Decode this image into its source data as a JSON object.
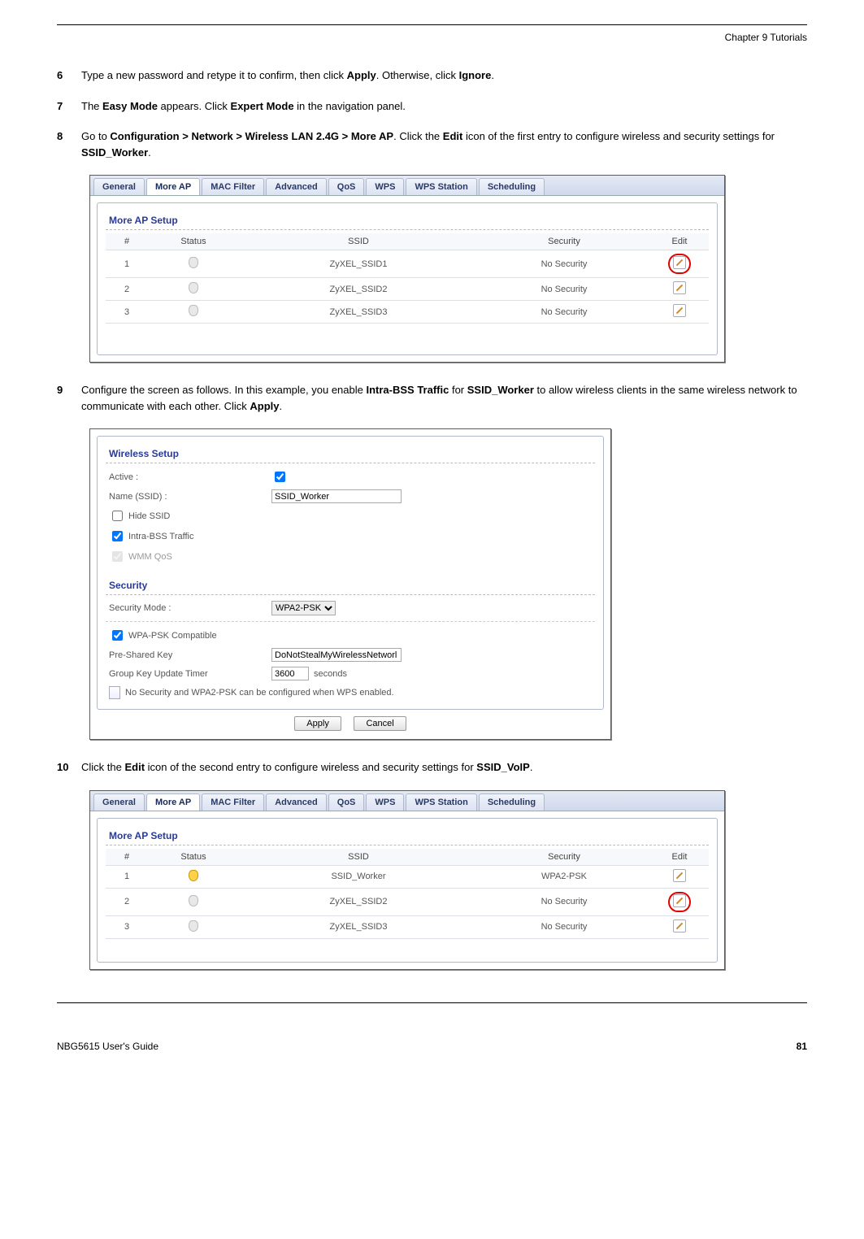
{
  "header": {
    "chapter": "Chapter 9 Tutorials"
  },
  "steps": {
    "6": {
      "num": "6",
      "p1a": "Type a new password and retype it to confirm, then click ",
      "b1": "Apply",
      "p1b": ". Otherwise, click ",
      "b2": "Ignore",
      "p1c": "."
    },
    "7": {
      "num": "7",
      "p1a": "The ",
      "b1": "Easy Mode",
      "p1b": " appears. Click ",
      "b2": "Expert Mode",
      "p1c": " in the navigation panel."
    },
    "8": {
      "num": "8",
      "p1a": "Go to ",
      "b1": "Configuration > Network > Wireless LAN 2.4G > More AP",
      "p1b": ". Click the ",
      "b2": "Edit",
      "p1c": " icon of the first entry to configure wireless and security settings for ",
      "b3": "SSID_Worker",
      "p1d": "."
    },
    "9": {
      "num": "9",
      "p1a": "Configure the screen as follows. In this example, you enable ",
      "b1": "Intra-BSS Traffic",
      "p1b": " for ",
      "b2": "SSID_Worker",
      "p1c": " to allow wireless clients in the same wireless network to communicate with each other. Click ",
      "b3": "Apply",
      "p1d": "."
    },
    "10": {
      "num": "10",
      "p1a": "Click the ",
      "b1": "Edit",
      "p1b": " icon of the second entry to configure wireless and security settings for ",
      "b2": "SSID_VoIP",
      "p1c": "."
    }
  },
  "shot1": {
    "tabs": [
      "General",
      "More AP",
      "MAC Filter",
      "Advanced",
      "QoS",
      "WPS",
      "WPS Station",
      "Scheduling"
    ],
    "active_tab_index": 1,
    "section": "More AP Setup",
    "cols": {
      "num": "#",
      "status": "Status",
      "ssid": "SSID",
      "security": "Security",
      "edit": "Edit"
    },
    "rows": [
      {
        "num": "1",
        "ssid": "ZyXEL_SSID1",
        "security": "No Security",
        "highlight": true,
        "on": false
      },
      {
        "num": "2",
        "ssid": "ZyXEL_SSID2",
        "security": "No Security",
        "highlight": false,
        "on": false
      },
      {
        "num": "3",
        "ssid": "ZyXEL_SSID3",
        "security": "No Security",
        "highlight": false,
        "on": false
      }
    ]
  },
  "shot2": {
    "section1": "Wireless Setup",
    "active_label": "Active :",
    "name_label": "Name (SSID) :",
    "name_value": "SSID_Worker",
    "hide_ssid": "Hide SSID",
    "intra_bss": "Intra-BSS Traffic",
    "wmm": "WMM QoS",
    "section2": "Security",
    "sec_mode_label": "Security Mode :",
    "sec_mode_value": "WPA2-PSK",
    "wpa_compat": "WPA-PSK Compatible",
    "psk_label": "Pre-Shared Key",
    "psk_value": "DoNotStealMyWirelessNetworl",
    "grp_label": "Group Key Update Timer",
    "grp_value": "3600",
    "grp_unit": "seconds",
    "note": "No Security and WPA2-PSK can be configured when WPS enabled.",
    "apply": "Apply",
    "cancel": "Cancel"
  },
  "shot3": {
    "tabs": [
      "General",
      "More AP",
      "MAC Filter",
      "Advanced",
      "QoS",
      "WPS",
      "WPS Station",
      "Scheduling"
    ],
    "active_tab_index": 1,
    "section": "More AP Setup",
    "cols": {
      "num": "#",
      "status": "Status",
      "ssid": "SSID",
      "security": "Security",
      "edit": "Edit"
    },
    "rows": [
      {
        "num": "1",
        "ssid": "SSID_Worker",
        "security": "WPA2-PSK",
        "highlight": false,
        "on": true
      },
      {
        "num": "2",
        "ssid": "ZyXEL_SSID2",
        "security": "No Security",
        "highlight": true,
        "on": false
      },
      {
        "num": "3",
        "ssid": "ZyXEL_SSID3",
        "security": "No Security",
        "highlight": false,
        "on": false
      }
    ]
  },
  "footer": {
    "guide": "NBG5615 User's Guide",
    "page": "81"
  }
}
